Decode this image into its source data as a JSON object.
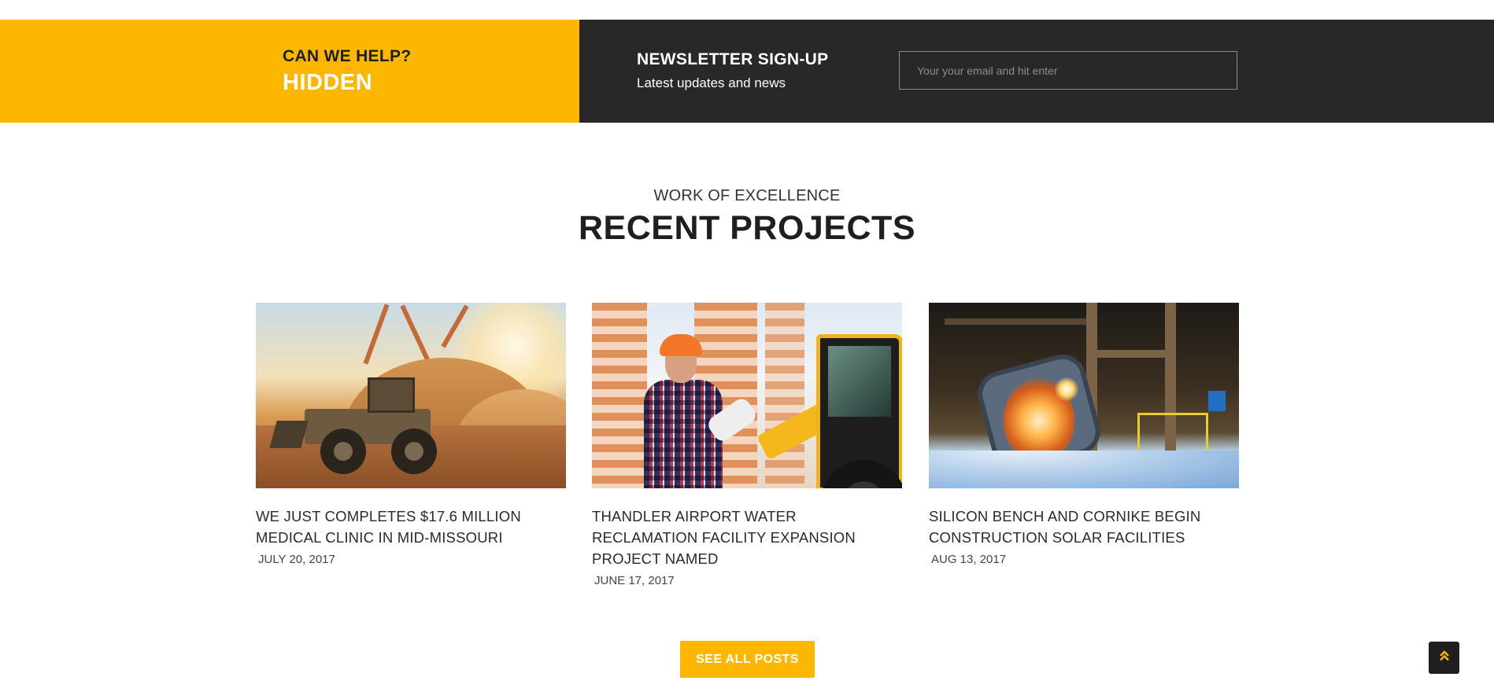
{
  "topbar": {
    "help_question": "CAN WE HELP?",
    "help_value": "HIDDEN",
    "newsletter_title": "NEWSLETTER SIGN-UP",
    "newsletter_subtitle": "Latest updates and news",
    "email_placeholder": "Your your email and hit enter"
  },
  "section": {
    "kicker": "WORK OF EXCELLENCE",
    "title": "RECENT PROJECTS"
  },
  "projects": [
    {
      "title": "WE JUST COMPLETES $17.6 MILLION MEDICAL CLINIC IN MID-MISSOURI",
      "date": "JULY 20, 2017",
      "image": "wheel-loader-photo"
    },
    {
      "title": "THANDLER AIRPORT WATER RECLAMATION FACILITY EXPANSION PROJECT NAMED",
      "date": "JUNE 17, 2017",
      "image": "engineer-with-excavator-photo"
    },
    {
      "title": "SILICON BENCH AND CORNIKE BEGIN CONSTRUCTION SOLAR FACILITIES",
      "date": "AUG 13, 2017",
      "image": "steel-foundry-photo"
    }
  ],
  "see_all_label": "SEE ALL POSTS",
  "back_to_top_icon": "double-chevron-up-icon",
  "colors": {
    "accent": "#fdb701",
    "dark": "#282828",
    "text": "#1f1f1f"
  }
}
